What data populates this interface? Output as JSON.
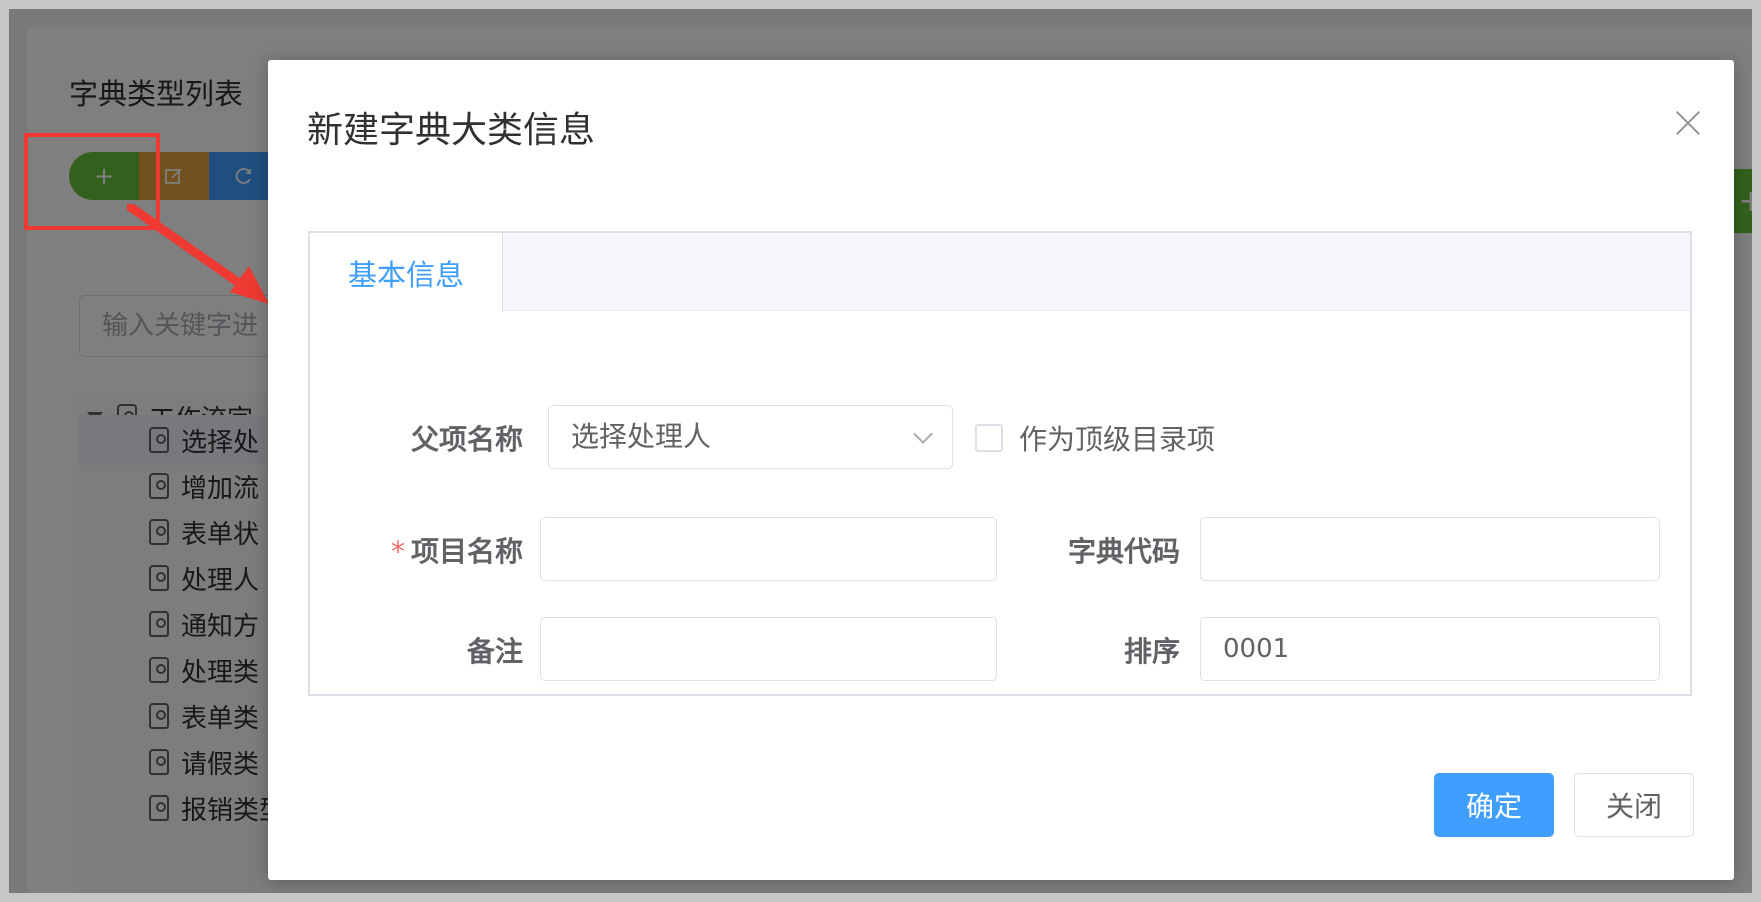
{
  "background": {
    "panel_title": "字典类型列表",
    "search_placeholder": "输入关键字进",
    "tree": [
      {
        "label": "工作流字",
        "level": 0,
        "expanded": true
      },
      {
        "label": "选择处",
        "level": 1,
        "selected": true
      },
      {
        "label": "增加流",
        "level": 1
      },
      {
        "label": "表单状",
        "level": 1
      },
      {
        "label": "处理人",
        "level": 1
      },
      {
        "label": "通知方",
        "level": 1
      },
      {
        "label": "处理类",
        "level": 1
      },
      {
        "label": "表单类",
        "level": 1
      },
      {
        "label": "请假类",
        "level": 1
      },
      {
        "label": "报销类型",
        "level": 1
      }
    ],
    "toolbar_icons": [
      "plus-icon",
      "edit-icon",
      "refresh-icon"
    ]
  },
  "dialog": {
    "title": "新建字典大类信息",
    "tabs": [
      {
        "label": "基本信息",
        "active": true
      }
    ],
    "form": {
      "parent_label": "父项名称",
      "parent_value": "选择处理人",
      "top_level_label": "作为顶级目录项",
      "top_level_checked": false,
      "name_label": "项目名称",
      "name_value": "",
      "name_required": "*",
      "code_label": "字典代码",
      "code_value": "",
      "remark_label": "备注",
      "remark_value": "",
      "sort_label": "排序",
      "sort_value": "0001"
    },
    "confirm_label": "确定",
    "close_label": "关闭"
  },
  "colors": {
    "primary": "#409eff",
    "success": "#67c23a",
    "warning": "#e6a23c",
    "danger": "#f56c6c",
    "annotation": "#ee3a32"
  }
}
